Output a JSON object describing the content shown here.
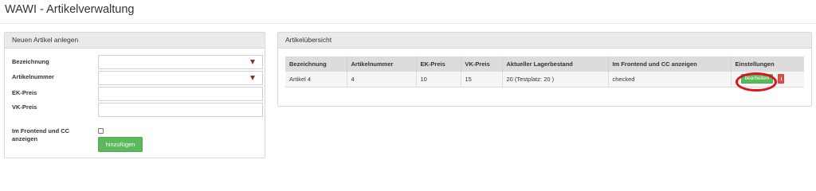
{
  "app": {
    "title": "WAWI - Artikelverwaltung"
  },
  "new_article": {
    "heading": "Neuen Artikel anlegen",
    "fields": [
      {
        "label": "Bezeichnung",
        "value": "",
        "has_icon": true
      },
      {
        "label": "Artikelnummer",
        "value": "",
        "has_icon": true
      },
      {
        "label": "EK-Preis",
        "value": ""
      },
      {
        "label": "VK-Preis",
        "value": ""
      }
    ],
    "frontend_label": "Im Frontend und CC anzeigen",
    "frontend_checked": false,
    "add_label": "hinzufügen"
  },
  "overview": {
    "heading": "Artikelübersicht",
    "columns": [
      "Bezeichnung",
      "Artikelnummer",
      "EK-Preis",
      "VK-Preis",
      "Aktueller Lagerbestand",
      "Im Frontend und CC anzeigen",
      "Einstellungen"
    ],
    "rows": [
      {
        "name": "Artikel 4",
        "number": "4",
        "ek": "10",
        "vk": "15",
        "stock": "20 (Testplatz: 20 )",
        "frontend": "checked",
        "edit_label": "bearbeiten"
      }
    ]
  },
  "colors": {
    "accent_green": "#5cb85c",
    "danger_red": "#d9534f",
    "highlight": "#e0101c"
  },
  "icons": {
    "input_icon": "autofill-key-icon",
    "delete": "delete-icon"
  }
}
